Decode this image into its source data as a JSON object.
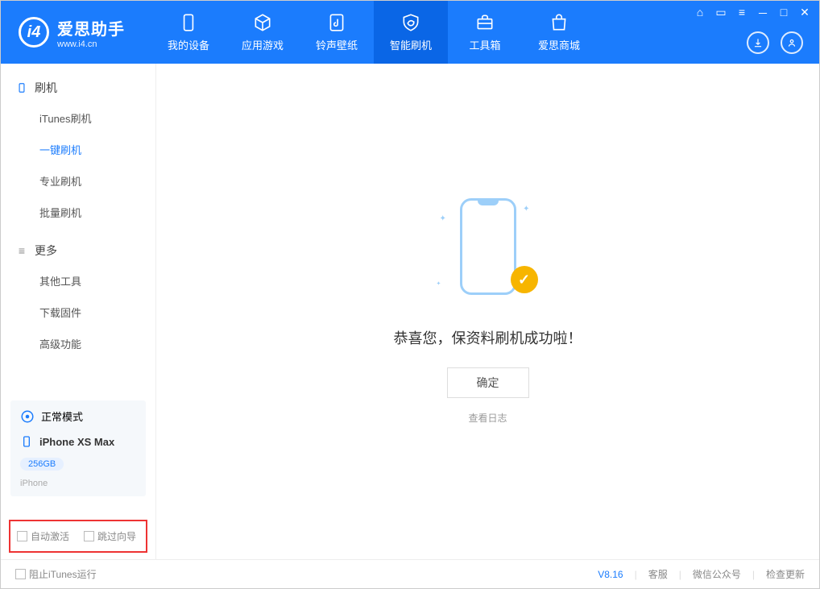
{
  "app": {
    "title": "爱思助手",
    "subtitle": "www.i4.cn"
  },
  "nav": {
    "items": [
      {
        "label": "我的设备"
      },
      {
        "label": "应用游戏"
      },
      {
        "label": "铃声壁纸"
      },
      {
        "label": "智能刷机"
      },
      {
        "label": "工具箱"
      },
      {
        "label": "爱思商城"
      }
    ]
  },
  "sidebar": {
    "group1": {
      "title": "刷机"
    },
    "items1": [
      {
        "label": "iTunes刷机"
      },
      {
        "label": "一键刷机"
      },
      {
        "label": "专业刷机"
      },
      {
        "label": "批量刷机"
      }
    ],
    "group2": {
      "title": "更多"
    },
    "items2": [
      {
        "label": "其他工具"
      },
      {
        "label": "下载固件"
      },
      {
        "label": "高级功能"
      }
    ],
    "mode": "正常模式",
    "device": {
      "name": "iPhone XS Max",
      "storage": "256GB",
      "type": "iPhone"
    },
    "opt1": "自动激活",
    "opt2": "跳过向导"
  },
  "main": {
    "success_message": "恭喜您，保资料刷机成功啦！",
    "ok_button": "确定",
    "log_link": "查看日志"
  },
  "footer": {
    "block_itunes": "阻止iTunes运行",
    "version": "V8.16",
    "service": "客服",
    "wechat": "微信公众号",
    "update": "检查更新"
  }
}
